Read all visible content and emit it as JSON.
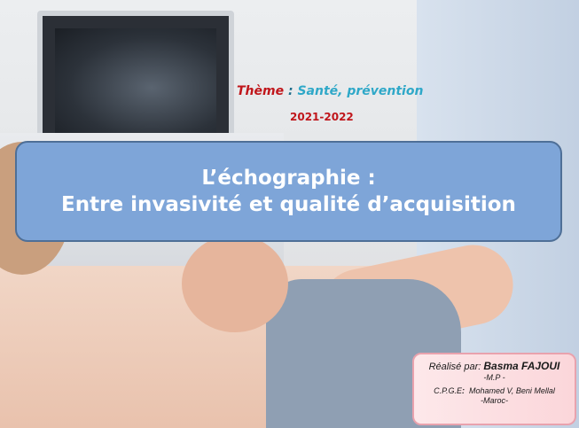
{
  "theme": {
    "label": "Thème",
    "separator": " : ",
    "value": "Santé, prévention"
  },
  "year": "2021-2022",
  "title": {
    "line1": "L’échographie :",
    "line2": "Entre invasivité et qualité d’acquisition"
  },
  "credit": {
    "made_by_label": "Réalisé par",
    "made_by_sep": ":",
    "author": "Basma FAJOUI",
    "role": "-M.P -",
    "school_label": "C.P.G.E",
    "school_sep": ":",
    "school_name": "Mohamed V,  Beni Mellal",
    "country": "-Maroc-"
  }
}
